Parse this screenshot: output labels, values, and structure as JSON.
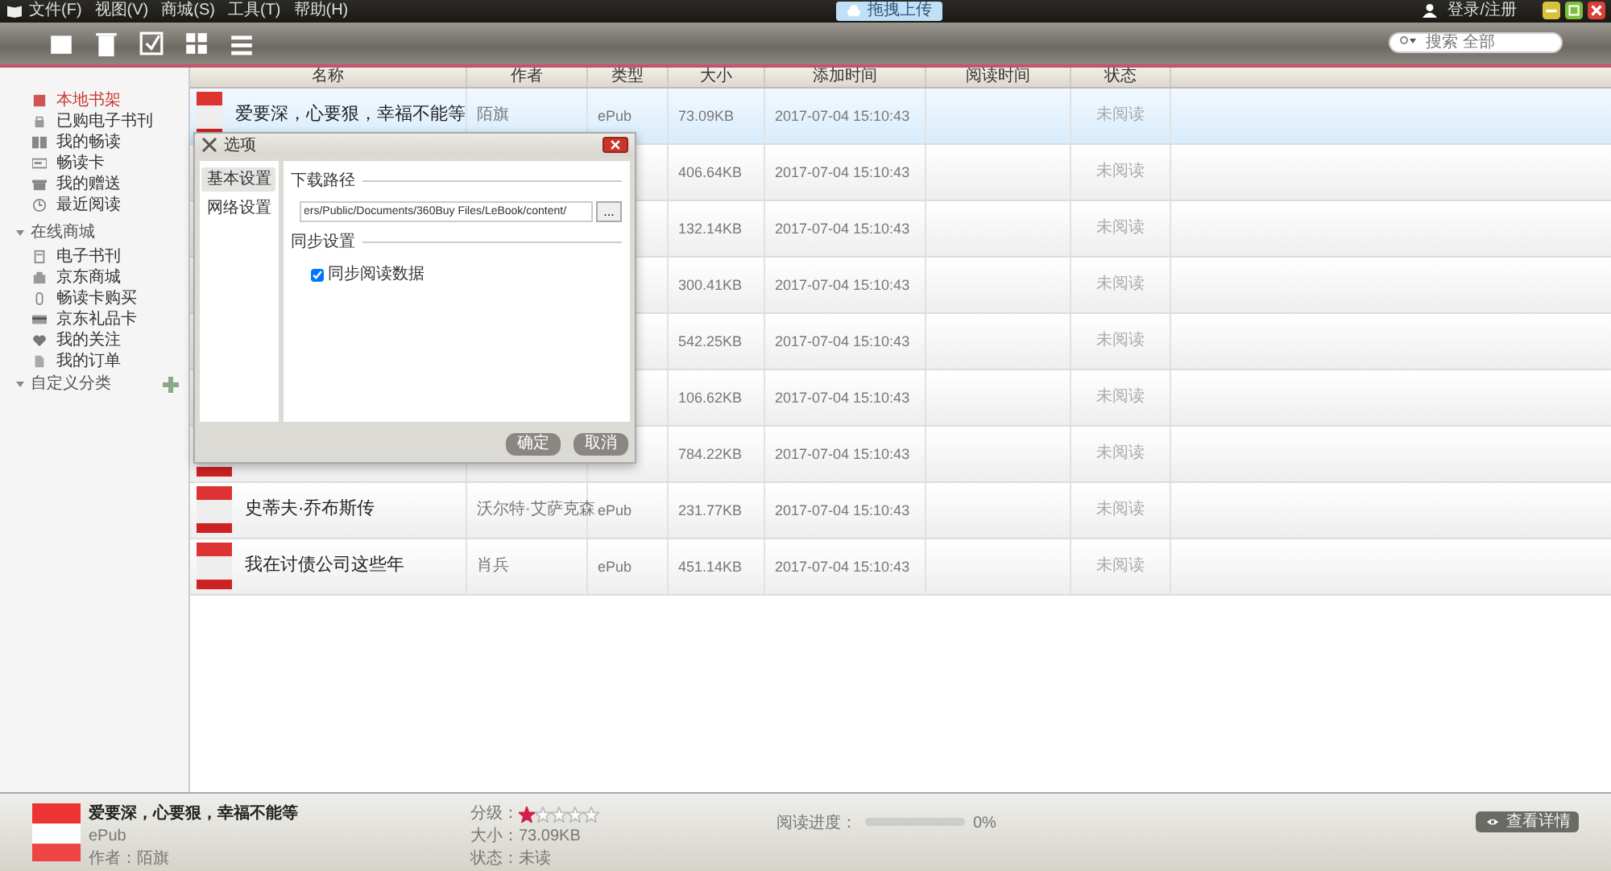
{
  "menu": [
    "文件(F)",
    "视图(V)",
    "商城(S)",
    "工具(T)",
    "帮助(H)"
  ],
  "upload_button": "拖拽上传",
  "login": "登录/注册",
  "search": {
    "placeholder": "搜索 全部"
  },
  "sidebar": {
    "groups": [
      {
        "items": [
          {
            "label": "本地书架",
            "selected": true
          },
          {
            "label": "已购电子书刊",
            "selected": false
          },
          {
            "label": "我的畅读",
            "selected": false
          },
          {
            "label": "畅读卡",
            "selected": false
          },
          {
            "label": "我的赠送",
            "selected": false
          },
          {
            "label": "最近阅读",
            "selected": false
          }
        ]
      },
      {
        "title": "在线商城",
        "items": [
          {
            "label": "电子书刊",
            "selected": false
          },
          {
            "label": "京东商城",
            "selected": false
          },
          {
            "label": "畅读卡购买",
            "selected": false
          },
          {
            "label": "京东礼品卡",
            "selected": false
          },
          {
            "label": "我的关注",
            "selected": false
          },
          {
            "label": "我的订单",
            "selected": false
          }
        ]
      },
      {
        "title": "自定义分类",
        "add": true
      }
    ]
  },
  "table": {
    "columns": [
      "名称",
      "作者",
      "类型",
      "大小",
      "添加时间",
      "阅读时间",
      "状态"
    ],
    "rows": [
      {
        "selected": true,
        "title": "爱要深，心要狠，幸福不能等",
        "author": "陌旗",
        "type": "ePub",
        "size": "73.09KB",
        "added": "2017-07-04 15:10:43",
        "status": "未阅读"
      },
      {
        "selected": false,
        "size": "406.64KB",
        "added": "2017-07-04 15:10:43",
        "status": "未阅读"
      },
      {
        "selected": false,
        "size": "132.14KB",
        "added": "2017-07-04 15:10:43",
        "status": "未阅读"
      },
      {
        "selected": false,
        "size": "300.41KB",
        "added": "2017-07-04 15:10:43",
        "status": "未阅读"
      },
      {
        "selected": false,
        "size": "542.25KB",
        "added": "2017-07-04 15:10:43",
        "status": "未阅读"
      },
      {
        "selected": false,
        "size": "106.62KB",
        "added": "2017-07-04 15:10:43",
        "status": "未阅读"
      },
      {
        "selected": false,
        "size": "784.22KB",
        "added": "2017-07-04 15:10:43",
        "status": "未阅读"
      },
      {
        "selected": false,
        "title": "史蒂夫·乔布斯传",
        "author": "沃尔特·艾萨克森",
        "type": "ePub",
        "size": "231.77KB",
        "added": "2017-07-04 15:10:43",
        "status": "未阅读"
      },
      {
        "selected": false,
        "title": "我在讨债公司这些年",
        "author": "肖兵",
        "type": "ePub",
        "size": "451.14KB",
        "added": "2017-07-04 15:10:43",
        "status": "未阅读"
      }
    ]
  },
  "dialog": {
    "title": "选项",
    "tabs": [
      {
        "label": "基本设置",
        "selected": true
      },
      {
        "label": "网络设置",
        "selected": false
      }
    ],
    "download_group": "下载路径",
    "download_path": "ers/Public/Documents/360Buy Files/LeBook/content/",
    "browse_button": "...",
    "sync_group": "同步设置",
    "sync_checkbox": {
      "label": "同步阅读数据",
      "checked": true
    },
    "buttons": [
      "确定",
      "取消"
    ]
  },
  "details": {
    "title": "爱要深，心要狠，幸福不能等",
    "type": "ePub",
    "author": "作者：陌旗",
    "rating_label": "分级：",
    "stars": 1,
    "size": "大小：73.09KB",
    "status": "状态：未读",
    "progress_label": "阅读进度：",
    "progress": {
      "level": 0
    },
    "progress_text": "0%",
    "view_button": "查看详情"
  }
}
